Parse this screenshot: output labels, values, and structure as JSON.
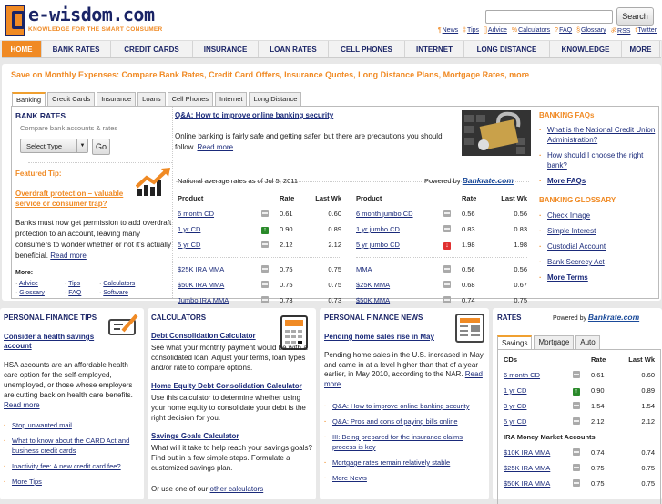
{
  "header": {
    "logo_name": "e-wisdom.com",
    "logo_tagline": "KNOWLEDGE FOR THE SMART CONSUMER",
    "search_value": "",
    "search_button": "Search",
    "top_links": [
      {
        "icon": "news-icon",
        "glyph": "¶",
        "label": "News"
      },
      {
        "icon": "tips-icon",
        "glyph": "‡",
        "label": "Tips"
      },
      {
        "icon": "advice-icon",
        "glyph": "[]",
        "label": "Advice"
      },
      {
        "icon": "calculator-icon",
        "glyph": "%",
        "label": "Calculators"
      },
      {
        "icon": "faq-icon",
        "glyph": "?",
        "label": "FAQ"
      },
      {
        "icon": "glossary-icon",
        "glyph": "§",
        "label": "Glossary"
      },
      {
        "icon": "rss-icon",
        "glyph": "ॐ",
        "label": "RSS"
      },
      {
        "icon": "twitter-icon",
        "glyph": "t",
        "label": "Twitter"
      }
    ]
  },
  "nav": [
    "HOME",
    "BANK RATES",
    "CREDIT CARDS",
    "INSURANCE",
    "LOAN RATES",
    "CELL PHONES",
    "INTERNET",
    "LONG DISTANCE",
    "KNOWLEDGE",
    "MORE"
  ],
  "tagline": "Save on Monthly Expenses: Compare Bank Rates, Credit Card Offers, Insurance Quotes, Long Distance Plans, Mortgage Rates, more",
  "tabs": [
    "Banking",
    "Credit Cards",
    "Insurance",
    "Loans",
    "Cell Phones",
    "Internet",
    "Long Distance"
  ],
  "bank_rates": {
    "title": "BANK RATES",
    "subtitle": "Compare bank accounts & rates",
    "select": "Select Type",
    "go": "Go",
    "featured_label": "Featured Tip:",
    "featured_link": "Overdraft protection – valuable service or consumer trap?",
    "featured_text": "Banks must now get permission to add overdraft protection to an account, leaving many consumers to wonder whether or not it's actually beneficial.",
    "read_more": "Read more",
    "more_label": "More:",
    "more_links": [
      "Advice",
      "Tips",
      "Calculators",
      "Glossary",
      "FAQ",
      "Software"
    ]
  },
  "article": {
    "title": "Q&A: How to improve online banking security",
    "text": "Online banking is fairly safe and getting safer, but there are precautions you should follow.",
    "read_more": "Read more"
  },
  "rates_table": {
    "as_of": "National average rates as of Jul 5, 2011",
    "powered_by": "Powered by",
    "provider": "Bankrate.com",
    "headers": [
      "Product",
      "Rate",
      "Last Wk"
    ],
    "left": [
      {
        "p": "6 month CD",
        "t": "eq",
        "r": "0.61",
        "l": "0.60"
      },
      {
        "p": "1 yr CD",
        "t": "up",
        "r": "0.90",
        "l": "0.89"
      },
      {
        "p": "5 yr CD",
        "t": "eq",
        "r": "2.12",
        "l": "2.12"
      },
      {
        "sep": true
      },
      {
        "p": "$25K IRA MMA",
        "t": "eq",
        "r": "0.75",
        "l": "0.75"
      },
      {
        "p": "$50K IRA MMA",
        "t": "eq",
        "r": "0.75",
        "l": "0.75"
      },
      {
        "p": "Jumbo IRA MMA",
        "t": "eq",
        "r": "0.73",
        "l": "0.73"
      }
    ],
    "right": [
      {
        "p": "6 month jumbo CD",
        "t": "eq",
        "r": "0.56",
        "l": "0.56"
      },
      {
        "p": "1 yr jumbo CD",
        "t": "eq",
        "r": "0.83",
        "l": "0.83"
      },
      {
        "p": "5 yr jumbo CD",
        "t": "down",
        "r": "1.98",
        "l": "1.98"
      },
      {
        "sep": true
      },
      {
        "p": "MMA",
        "t": "eq",
        "r": "0.56",
        "l": "0.56"
      },
      {
        "p": "$25K MMA",
        "t": "eq",
        "r": "0.68",
        "l": "0.67"
      },
      {
        "p": "$50K MMA",
        "t": "eq",
        "r": "0.74",
        "l": "0.75"
      }
    ]
  },
  "faqs": {
    "title": "BANKING FAQs",
    "items": [
      "What is the National Credit Union Administration?",
      "How should I choose the right bank?"
    ],
    "more": "More FAQs"
  },
  "glossary": {
    "title": "BANKING GLOSSARY",
    "items": [
      "Check Image",
      "Simple Interest",
      "Custodial Account",
      "Bank Secrecy Act"
    ],
    "more": "More Terms"
  },
  "tips": {
    "title": "PERSONAL FINANCE TIPS",
    "headline": "Consider a health savings account",
    "text": "HSA accounts are an affordable health care option for the self-employed, unemployed, or those whose employers are cutting back on health care benefits.",
    "read_more": "Read more",
    "links": [
      "Stop unwanted mail",
      "What to know about the CARD Act and business credit cards",
      "Inactivity fee: A new credit card fee?",
      "More Tips"
    ]
  },
  "calculators": {
    "title": "CALCULATORS",
    "items": [
      {
        "title": "Debt Consolidation Calculator",
        "text": "See what your monthly payment would be with a consolidated loan. Adjust your terms, loan types and/or rate to compare options."
      },
      {
        "title": "Home Equity Debt Consolidation Calculator",
        "text": "Use this calculator to determine whether using your home equity to consolidate your debt is the right decision for you."
      },
      {
        "title": "Savings Goals Calculator",
        "text": "What will it take to help reach your savings goals? Find out in a few simple steps. Formulate a customized savings plan."
      }
    ],
    "footer": "Or use one of our",
    "footer_link": "other calculators"
  },
  "news": {
    "title": "PERSONAL FINANCE NEWS",
    "headline": "Pending home sales rise in May",
    "text": "Pending home sales in the U.S. increased in May and came in at a level higher than that of a year earlier, in May 2010, according to the NAR.",
    "read_more": "Read more",
    "links": [
      "Q&A: How to improve online banking security",
      "Q&A: Pros and cons of paying bills online",
      "III: Being prepared for the insurance claims process is key",
      "Mortgage rates remain relatively stable",
      "More News"
    ]
  },
  "rates_panel": {
    "title": "RATES",
    "powered_by": "Powered by",
    "provider": "Bankrate.com",
    "tabs": [
      "Savings",
      "Mortgage",
      "Auto"
    ],
    "cd_header": [
      "CDs",
      "Rate",
      "Last Wk"
    ],
    "cds": [
      {
        "p": "6 month CD",
        "t": "eq",
        "r": "0.61",
        "l": "0.60"
      },
      {
        "p": "1 yr CD",
        "t": "up",
        "r": "0.90",
        "l": "0.89"
      },
      {
        "p": "3 yr CD",
        "t": "eq",
        "r": "1.54",
        "l": "1.54"
      },
      {
        "p": "5 yr CD",
        "t": "eq",
        "r": "2.12",
        "l": "2.12"
      }
    ],
    "ira_header": "IRA Money Market Accounts",
    "ira": [
      {
        "p": "$10K IRA MMA",
        "t": "eq",
        "r": "0.74",
        "l": "0.74"
      },
      {
        "p": "$25K IRA MMA",
        "t": "eq",
        "r": "0.75",
        "l": "0.75"
      },
      {
        "p": "$50K IRA MMA",
        "t": "eq",
        "r": "0.75",
        "l": "0.75"
      }
    ]
  },
  "colors": {
    "accent": "#f08a24",
    "navy": "#1a2466",
    "link": "#1a2a7a"
  }
}
